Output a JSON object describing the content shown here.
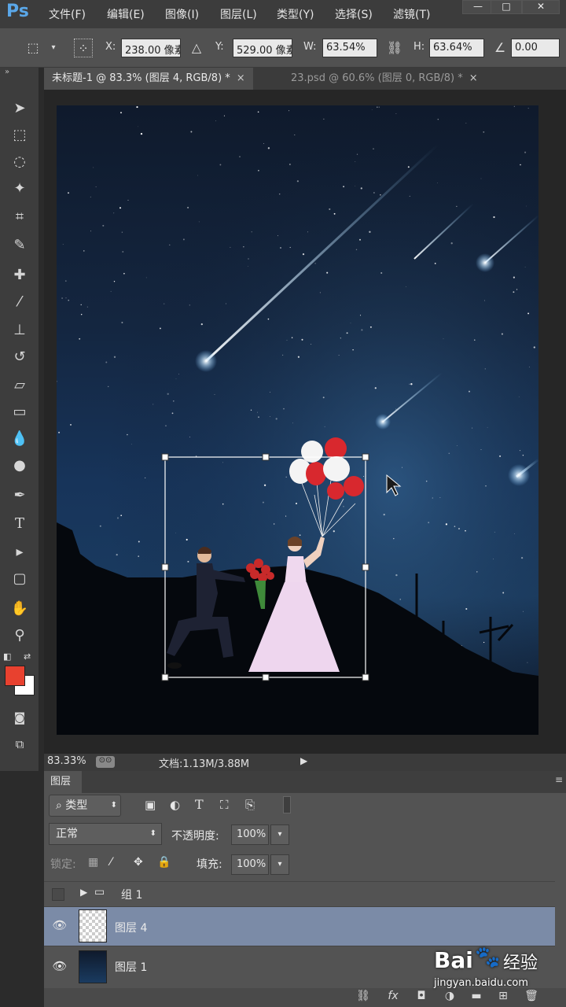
{
  "app": {
    "logo": "Ps"
  },
  "menu": [
    "文件(F)",
    "编辑(E)",
    "图像(I)",
    "图层(L)",
    "类型(Y)",
    "选择(S)",
    "滤镜(T)"
  ],
  "window_buttons": [
    "—",
    "□",
    "✕"
  ],
  "options": {
    "x_label": "X:",
    "x_value": "238.00 像素",
    "y_label": "Y:",
    "y_value": "529.00 像素",
    "w_label": "W:",
    "w_value": "63.54%",
    "h_label": "H:",
    "h_value": "63.64%",
    "angle_value": "0.00"
  },
  "tabs": [
    {
      "label": "未标题-1 @ 83.3% (图层 4, RGB/8) *",
      "close": "×"
    },
    {
      "label": "23.psd @ 60.6% (图层 0, RGB/8) *",
      "close": "×"
    }
  ],
  "status": {
    "zoom": "83.33%",
    "doc": "文档:1.13M/3.88M"
  },
  "layers_panel": {
    "title": "图层",
    "filter_label": "类型",
    "blend_mode": "正常",
    "opacity_label": "不透明度:",
    "opacity_value": "100%",
    "lock_label": "锁定:",
    "fill_label": "填充:",
    "fill_value": "100%",
    "layers": [
      {
        "name": "组 1",
        "type": "group",
        "visible": false
      },
      {
        "name": "图层 4",
        "type": "layer",
        "visible": true,
        "selected": true
      },
      {
        "name": "图层 1",
        "type": "layer",
        "visible": true
      }
    ]
  },
  "watermark": {
    "brand": "Bai",
    "brand2": "经验",
    "url": "jingyan.baidu.com"
  },
  "colors": {
    "foreground": "#e8412f",
    "background": "#ffffff",
    "selected_layer": "#7b8ba7",
    "accent_logo": "#5aa7e8"
  }
}
